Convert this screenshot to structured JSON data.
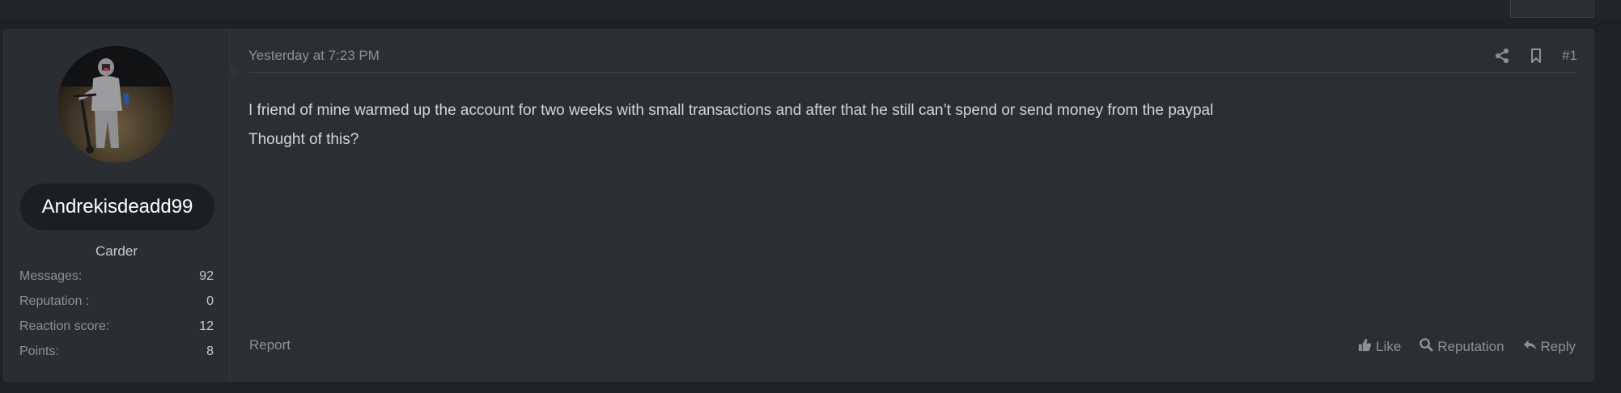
{
  "post": {
    "author": {
      "username": "Andrekisdeadd99",
      "title": "Carder",
      "stats": [
        {
          "label": "Messages:",
          "value": "92"
        },
        {
          "label": "Reputation :",
          "value": "0"
        },
        {
          "label": "Reaction score:",
          "value": "12"
        },
        {
          "label": "Points:",
          "value": "8"
        }
      ]
    },
    "timestamp": "Yesterday at 7:23 PM",
    "post_number": "#1",
    "body": {
      "line1": "I friend of mine warmed up the account for two weeks with small transactions and after that he still can’t spend or send money from the paypal",
      "line2": "Thought of this?"
    },
    "footer": {
      "report": "Report",
      "like": "Like",
      "reputation": "Reputation",
      "reply": "Reply"
    }
  },
  "icons": {
    "share": "share-icon",
    "bookmark": "bookmark-icon",
    "like": "thumbs-up-icon",
    "reputation": "search-icon",
    "reply": "reply-icon"
  }
}
